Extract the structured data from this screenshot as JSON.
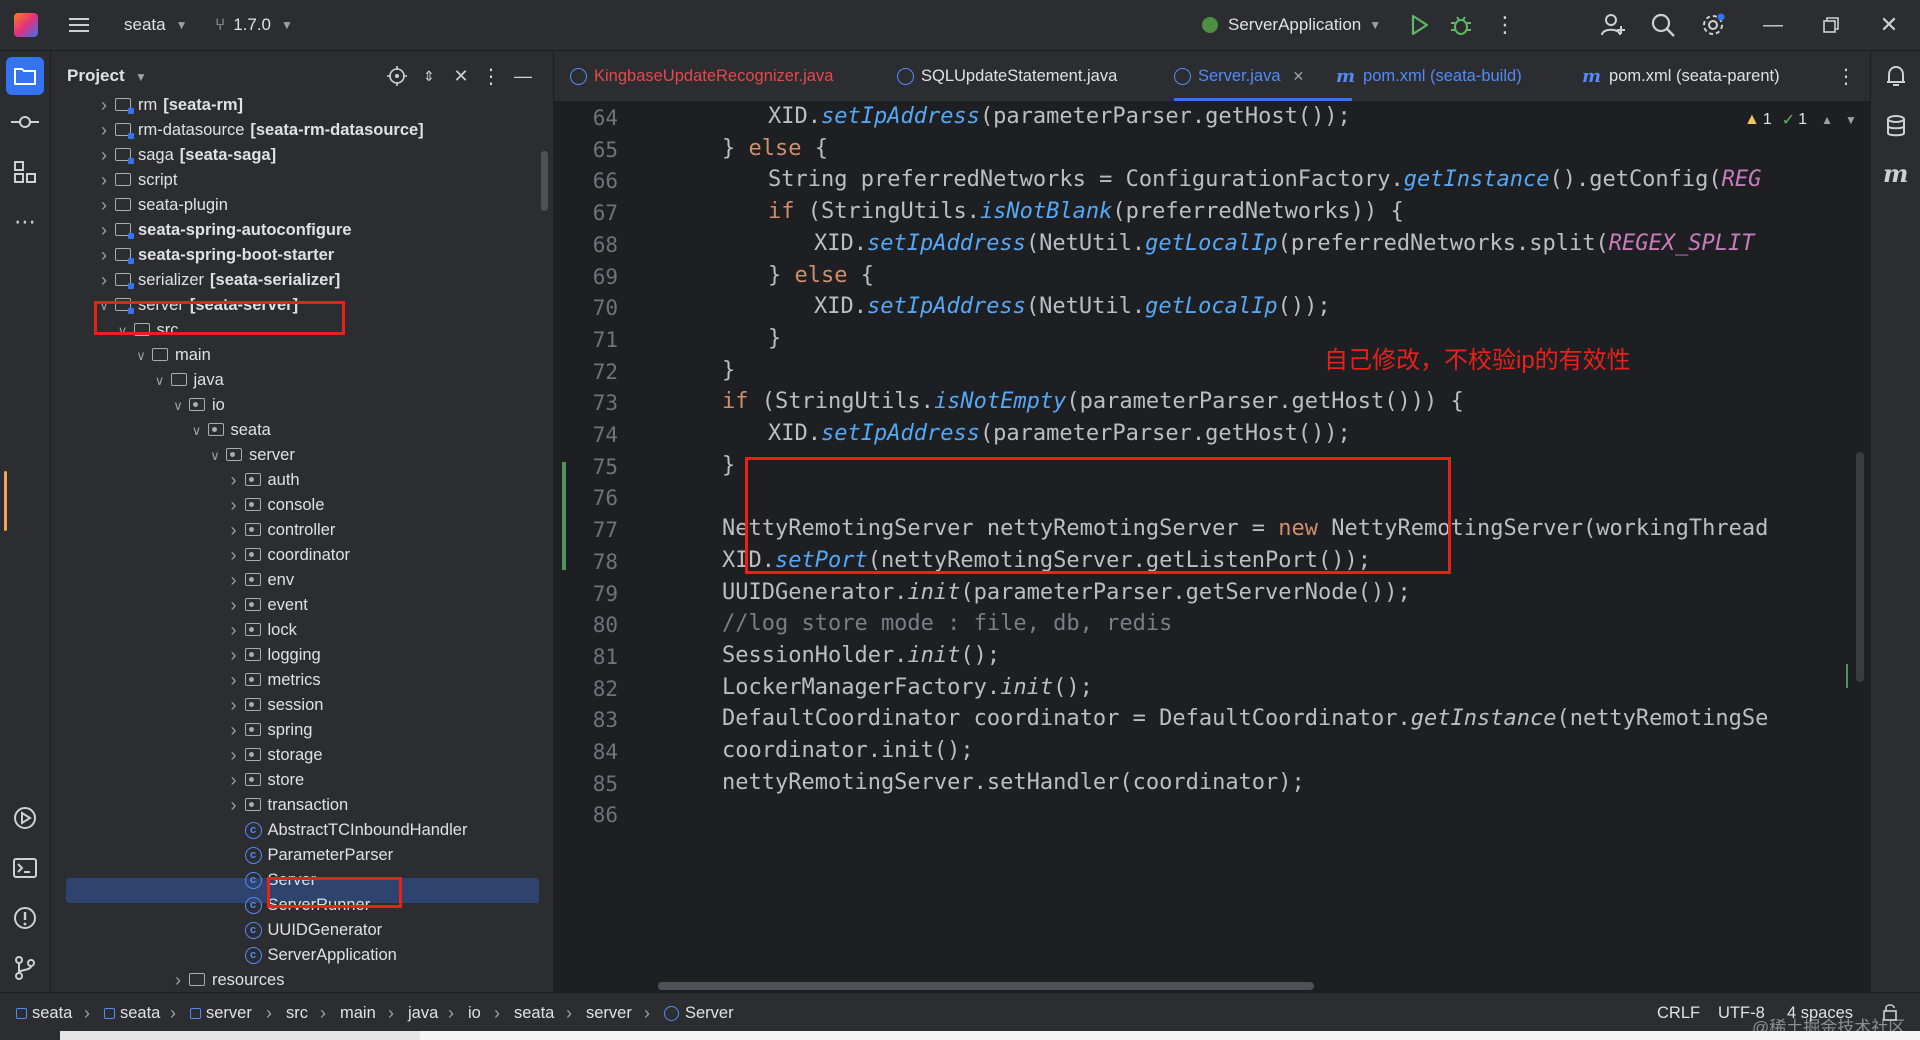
{
  "topbar": {
    "project": "seata",
    "branch": "1.7.0",
    "run_config": "ServerApplication"
  },
  "project_panel": {
    "title": "Project",
    "tree": [
      {
        "indent": 0,
        "chev": "›",
        "icon": "module",
        "name": "rm",
        "suffix": "[seata-rm]"
      },
      {
        "indent": 0,
        "chev": "›",
        "icon": "module",
        "name": "rm-datasource",
        "suffix": "[seata-rm-datasource]"
      },
      {
        "indent": 0,
        "chev": "›",
        "icon": "module",
        "name": "saga",
        "suffix": "[seata-saga]"
      },
      {
        "indent": 0,
        "chev": "›",
        "icon": "folder",
        "name": "script",
        "suffix": ""
      },
      {
        "indent": 0,
        "chev": "›",
        "icon": "folder",
        "name": "seata-plugin",
        "suffix": ""
      },
      {
        "indent": 0,
        "chev": "›",
        "icon": "module",
        "name": "seata-spring-autoconfigure",
        "suffix": "",
        "bold": true
      },
      {
        "indent": 0,
        "chev": "›",
        "icon": "module",
        "name": "seata-spring-boot-starter",
        "suffix": "",
        "bold": true
      },
      {
        "indent": 0,
        "chev": "›",
        "icon": "module",
        "name": "serializer",
        "suffix": "[seata-serializer]"
      },
      {
        "indent": 0,
        "chev": "⌄",
        "icon": "module",
        "name": "server",
        "suffix": "[seata-server]"
      },
      {
        "indent": 1,
        "chev": "⌄",
        "icon": "folder",
        "name": "src",
        "suffix": ""
      },
      {
        "indent": 2,
        "chev": "⌄",
        "icon": "folder",
        "name": "main",
        "suffix": ""
      },
      {
        "indent": 3,
        "chev": "⌄",
        "icon": "folder",
        "name": "java",
        "suffix": ""
      },
      {
        "indent": 4,
        "chev": "⌄",
        "icon": "package",
        "name": "io",
        "suffix": ""
      },
      {
        "indent": 5,
        "chev": "⌄",
        "icon": "package",
        "name": "seata",
        "suffix": ""
      },
      {
        "indent": 6,
        "chev": "⌄",
        "icon": "package",
        "name": "server",
        "suffix": ""
      },
      {
        "indent": 7,
        "chev": "›",
        "icon": "package",
        "name": "auth",
        "suffix": ""
      },
      {
        "indent": 7,
        "chev": "›",
        "icon": "package",
        "name": "console",
        "suffix": ""
      },
      {
        "indent": 7,
        "chev": "›",
        "icon": "package",
        "name": "controller",
        "suffix": ""
      },
      {
        "indent": 7,
        "chev": "›",
        "icon": "package",
        "name": "coordinator",
        "suffix": ""
      },
      {
        "indent": 7,
        "chev": "›",
        "icon": "package",
        "name": "env",
        "suffix": ""
      },
      {
        "indent": 7,
        "chev": "›",
        "icon": "package",
        "name": "event",
        "suffix": ""
      },
      {
        "indent": 7,
        "chev": "›",
        "icon": "package",
        "name": "lock",
        "suffix": ""
      },
      {
        "indent": 7,
        "chev": "›",
        "icon": "package",
        "name": "logging",
        "suffix": ""
      },
      {
        "indent": 7,
        "chev": "›",
        "icon": "package",
        "name": "metrics",
        "suffix": ""
      },
      {
        "indent": 7,
        "chev": "›",
        "icon": "package",
        "name": "session",
        "suffix": ""
      },
      {
        "indent": 7,
        "chev": "›",
        "icon": "package",
        "name": "spring",
        "suffix": ""
      },
      {
        "indent": 7,
        "chev": "›",
        "icon": "package",
        "name": "storage",
        "suffix": ""
      },
      {
        "indent": 7,
        "chev": "›",
        "icon": "package",
        "name": "store",
        "suffix": ""
      },
      {
        "indent": 7,
        "chev": "›",
        "icon": "package",
        "name": "transaction",
        "suffix": ""
      },
      {
        "indent": 7,
        "chev": "",
        "icon": "class",
        "name": "AbstractTCInboundHandler",
        "suffix": ""
      },
      {
        "indent": 7,
        "chev": "",
        "icon": "class",
        "name": "ParameterParser",
        "suffix": ""
      },
      {
        "indent": 7,
        "chev": "",
        "icon": "class",
        "name": "Server",
        "suffix": "",
        "selected": true
      },
      {
        "indent": 7,
        "chev": "",
        "icon": "class",
        "name": "ServerRunner",
        "suffix": ""
      },
      {
        "indent": 7,
        "chev": "",
        "icon": "class",
        "name": "UUIDGenerator",
        "suffix": ""
      },
      {
        "indent": 7,
        "chev": "",
        "icon": "class",
        "name": "ServerApplication",
        "suffix": ""
      },
      {
        "indent": 4,
        "chev": "›",
        "icon": "folder",
        "name": "resources",
        "suffix": ""
      }
    ]
  },
  "tabs": [
    {
      "label": "KingbaseUpdateRecognizer.java",
      "kind": "class",
      "color": "#e5484d"
    },
    {
      "label": "SQLUpdateStatement.java",
      "kind": "class",
      "color": "#dfe1e5"
    },
    {
      "label": "Server.java",
      "kind": "class",
      "color": "#548af7",
      "active": true
    },
    {
      "label": "pom.xml (seata-build)",
      "kind": "maven",
      "color": "#548af7"
    },
    {
      "label": "pom.xml (seata-parent)",
      "kind": "maven",
      "color": "#dfe1e5"
    }
  ],
  "inspections": {
    "warnings": "1",
    "ok": "1"
  },
  "editor": {
    "lines": [
      {
        "n": "64",
        "indent": 2,
        "tokens": [
          [
            "p",
            "XID."
          ],
          [
            "fi",
            "setIpAddress"
          ],
          [
            "p",
            "(parameterParser.getHost());"
          ]
        ]
      },
      {
        "n": "65",
        "indent": 1,
        "tokens": [
          [
            "p",
            "} "
          ],
          [
            "kw",
            "else"
          ],
          [
            "p",
            " {"
          ]
        ]
      },
      {
        "n": "66",
        "indent": 2,
        "tokens": [
          [
            "p",
            "String preferredNetworks = ConfigurationFactory."
          ],
          [
            "fi",
            "getInstance"
          ],
          [
            "p",
            "().getConfig("
          ],
          [
            "cst",
            "REG"
          ]
        ]
      },
      {
        "n": "67",
        "indent": 2,
        "tokens": [
          [
            "kw",
            "if"
          ],
          [
            "p",
            " (StringUtils."
          ],
          [
            "fi",
            "isNotBlank"
          ],
          [
            "p",
            "(preferredNetworks)) {"
          ]
        ]
      },
      {
        "n": "68",
        "indent": 3,
        "tokens": [
          [
            "p",
            "XID."
          ],
          [
            "fi",
            "setIpAddress"
          ],
          [
            "p",
            "(NetUtil."
          ],
          [
            "fi",
            "getLocalIp"
          ],
          [
            "p",
            "(preferredNetworks.split("
          ],
          [
            "cst",
            "REGEX_SPLIT"
          ]
        ]
      },
      {
        "n": "69",
        "indent": 2,
        "tokens": [
          [
            "p",
            "} "
          ],
          [
            "kw",
            "else"
          ],
          [
            "p",
            " {"
          ]
        ]
      },
      {
        "n": "70",
        "indent": 3,
        "tokens": [
          [
            "p",
            "XID."
          ],
          [
            "fi",
            "setIpAddress"
          ],
          [
            "p",
            "(NetUtil."
          ],
          [
            "fi",
            "getLocalIp"
          ],
          [
            "p",
            "());"
          ]
        ]
      },
      {
        "n": "71",
        "indent": 2,
        "tokens": [
          [
            "p",
            "}"
          ]
        ]
      },
      {
        "n": "72",
        "indent": 1,
        "tokens": [
          [
            "p",
            "}"
          ]
        ]
      },
      {
        "n": "73",
        "indent": 1,
        "tokens": [
          [
            "kw",
            "if"
          ],
          [
            "p",
            " (StringUtils."
          ],
          [
            "fi",
            "isNotEmpty"
          ],
          [
            "p",
            "(parameterParser.getHost())) {"
          ]
        ]
      },
      {
        "n": "74",
        "indent": 2,
        "tokens": [
          [
            "p",
            "XID."
          ],
          [
            "fi",
            "setIpAddress"
          ],
          [
            "p",
            "(parameterParser.getHost());"
          ]
        ]
      },
      {
        "n": "75",
        "indent": 1,
        "tokens": [
          [
            "p",
            "}"
          ]
        ]
      },
      {
        "n": "76",
        "indent": 0,
        "tokens": []
      },
      {
        "n": "77",
        "indent": 1,
        "tokens": [
          [
            "p",
            "NettyRemotingServer nettyRemotingServer = "
          ],
          [
            "kw",
            "new"
          ],
          [
            "p",
            " NettyRemotingServer(workingThread"
          ]
        ]
      },
      {
        "n": "78",
        "indent": 1,
        "tokens": [
          [
            "p",
            "XID."
          ],
          [
            "fi",
            "setPort"
          ],
          [
            "p",
            "(nettyRemotingServer.getListenPort());"
          ]
        ]
      },
      {
        "n": "79",
        "indent": 1,
        "tokens": [
          [
            "p",
            "UUIDGenerator."
          ],
          [
            "it",
            "init"
          ],
          [
            "p",
            "(parameterParser.getServerNode());"
          ]
        ]
      },
      {
        "n": "80",
        "indent": 1,
        "tokens": [
          [
            "cm",
            "//log store mode : file, db, redis"
          ]
        ]
      },
      {
        "n": "81",
        "indent": 1,
        "tokens": [
          [
            "p",
            "SessionHolder."
          ],
          [
            "it",
            "init"
          ],
          [
            "p",
            "();"
          ]
        ]
      },
      {
        "n": "82",
        "indent": 1,
        "tokens": [
          [
            "p",
            "LockerManagerFactory."
          ],
          [
            "it",
            "init"
          ],
          [
            "p",
            "();"
          ]
        ]
      },
      {
        "n": "83",
        "indent": 1,
        "tokens": [
          [
            "p",
            "DefaultCoordinator coordinator = DefaultCoordinator."
          ],
          [
            "it",
            "getInstance"
          ],
          [
            "p",
            "(nettyRemotingSe"
          ]
        ]
      },
      {
        "n": "84",
        "indent": 1,
        "tokens": [
          [
            "p",
            "coordinator.init();"
          ]
        ]
      },
      {
        "n": "85",
        "indent": 1,
        "tokens": [
          [
            "p",
            "nettyRemotingServer.setHandler(coordinator);"
          ]
        ]
      },
      {
        "n": "86",
        "indent": 0,
        "tokens": []
      }
    ],
    "annotation": "自己修改，不校验ip的有效性"
  },
  "status": {
    "breadcrumbs": [
      "seata",
      "seata",
      "server",
      "src",
      "main",
      "java",
      "io",
      "seata",
      "server",
      "Server"
    ],
    "line_sep": "CRLF",
    "encoding": "UTF-8",
    "indent": "4 spaces",
    "watermark": "@稀土掘金技术社区"
  },
  "colors": {
    "accent": "#3574f0",
    "highlight": "#e8211b",
    "keyword": "#cf8e6d",
    "function": "#56a8f5"
  }
}
